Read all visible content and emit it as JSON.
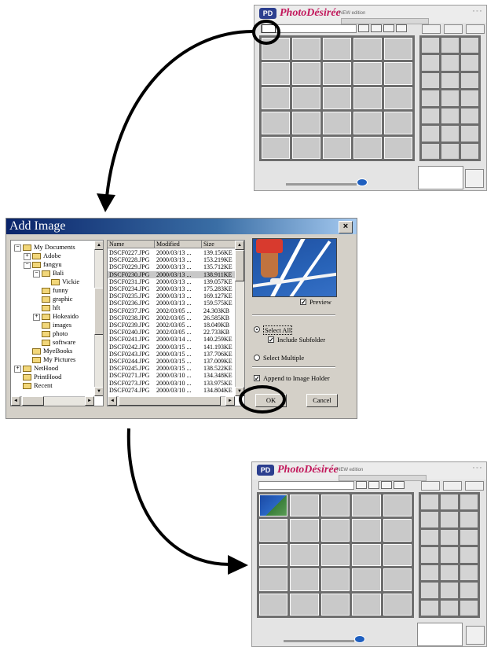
{
  "app": {
    "logo_mark": "PD",
    "logo_text": "PhotoDésirée",
    "logo_subtitle": "NEW edition"
  },
  "dialog": {
    "title": "Add Image",
    "close_glyph": "×",
    "folder_tree": [
      {
        "label": "My Documents",
        "toggle": "−"
      },
      {
        "label": "Adobe",
        "toggle": "+"
      },
      {
        "label": "fangyu",
        "toggle": "−"
      },
      {
        "label": "Bali",
        "toggle": "−"
      },
      {
        "label": "Vickie",
        "toggle": ""
      },
      {
        "label": "funny",
        "toggle": ""
      },
      {
        "label": "graphic",
        "toggle": ""
      },
      {
        "label": "hft",
        "toggle": ""
      },
      {
        "label": "Hokeaido",
        "toggle": "+"
      },
      {
        "label": "images",
        "toggle": ""
      },
      {
        "label": "photo",
        "toggle": ""
      },
      {
        "label": "software",
        "toggle": ""
      },
      {
        "label": "MyeBooks",
        "toggle": ""
      },
      {
        "label": "My Pictures",
        "toggle": ""
      },
      {
        "label": "NetHood",
        "toggle": "+"
      },
      {
        "label": "PrintHood",
        "toggle": ""
      },
      {
        "label": "Recent",
        "toggle": ""
      }
    ],
    "file_columns": [
      "Name",
      "Modified",
      "Size"
    ],
    "files": [
      [
        "DSCF0227.JPG",
        "2000/03/13 ...",
        "139.156KE"
      ],
      [
        "DSCF0228.JPG",
        "2000/03/13 ...",
        "153.219KE"
      ],
      [
        "DSCF0229.JPG",
        "2000/03/13 ...",
        "135.712KE"
      ],
      [
        "DSCF0230.JPG",
        "2000/03/13 ...",
        "138.911KE"
      ],
      [
        "DSCF0231.JPG",
        "2000/03/13 ...",
        "139.057KE"
      ],
      [
        "DSCF0234.JPG",
        "2000/03/13 ...",
        "175.283KE"
      ],
      [
        "DSCF0235.JPG",
        "2000/03/13 ...",
        "169.127KE"
      ],
      [
        "DSCF0236.JPG",
        "2000/03/13 ...",
        "159.575KE"
      ],
      [
        "DSCF0237.JPG",
        "2002/03/05 ...",
        "24.303KB"
      ],
      [
        "DSCF0238.JPG",
        "2002/03/05 ...",
        "26.585KB"
      ],
      [
        "DSCF0239.JPG",
        "2002/03/05 ...",
        "18.049KB"
      ],
      [
        "DSCF0240.JPG",
        "2002/03/05 ...",
        "22.733KB"
      ],
      [
        "DSCF0241.JPG",
        "2000/03/14 ...",
        "140.259KE"
      ],
      [
        "DSCF0242.JPG",
        "2000/03/15 ...",
        "141.193KE"
      ],
      [
        "DSCF0243.JPG",
        "2000/03/15 ...",
        "137.706KE"
      ],
      [
        "DSCF0244.JPG",
        "2000/03/15 ...",
        "137.009KE"
      ],
      [
        "DSCF0245.JPG",
        "2000/03/15 ...",
        "138.522KE"
      ],
      [
        "DSCF0271.JPG",
        "2000/03/10 ...",
        "134.348KE"
      ],
      [
        "DSCF0273.JPG",
        "2000/03/10 ...",
        "133.975KE"
      ],
      [
        "DSCF0274.JPG",
        "2000/03/10 ...",
        "134.804KE"
      ]
    ],
    "selected_file_index": 3,
    "preview_label": "Preview",
    "preview_checked": true,
    "select_all_label": "Select All",
    "include_subfolder_label": "Include Subfolder",
    "include_subfolder_checked": true,
    "select_multiple_label": "Select Multiple",
    "append_label": "Append to Image Holder",
    "append_checked": true,
    "ok_label": "OK",
    "cancel_label": "Cancel",
    "check_glyph": "✓",
    "scroll_up_glyph": "▲",
    "scroll_down_glyph": "▼",
    "scroll_left_glyph": "◄",
    "scroll_right_glyph": "►"
  },
  "colors": {
    "title_bar": "#0a246a",
    "dialog_face": "#d4d0c8",
    "highlight_circle": "#000000",
    "arrow": "#000000"
  },
  "icons": [
    "folder-icon",
    "close-icon",
    "checkbox-icon",
    "radio-icon",
    "arrow-icon",
    "highlight-circle-icon"
  ]
}
